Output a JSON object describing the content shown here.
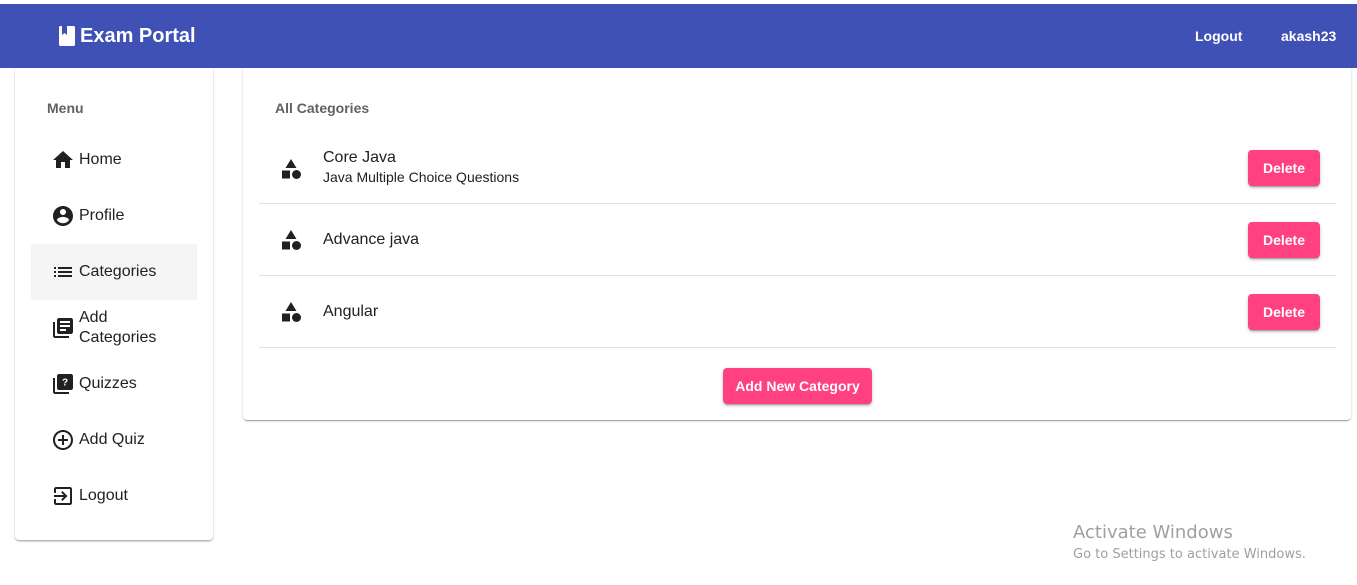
{
  "header": {
    "title": "Exam Portal",
    "logout_label": "Logout",
    "username": "akash23",
    "bg_color": "#3f51b5"
  },
  "sidebar": {
    "heading": "Menu",
    "items": [
      {
        "label": "Home",
        "icon": "home-icon"
      },
      {
        "label": "Profile",
        "icon": "account-circle-icon"
      },
      {
        "label": "Categories",
        "icon": "list-icon",
        "active": true
      },
      {
        "label": "Add\nCategories",
        "label_line1": "Add",
        "label_line2": "Categories",
        "icon": "library-books-icon"
      },
      {
        "label": "Quizzes",
        "icon": "quiz-icon"
      },
      {
        "label": "Add Quiz",
        "icon": "add-circle-icon"
      },
      {
        "label": "Logout",
        "icon": "logout-icon"
      }
    ]
  },
  "main": {
    "subtitle": "All Categories",
    "categories": [
      {
        "title": "Core Java",
        "description": "Java Multiple Choice Questions",
        "icon": "category-icon"
      },
      {
        "title": "Advance java",
        "description": "",
        "icon": "category-icon"
      },
      {
        "title": "Angular",
        "description": "",
        "icon": "category-icon"
      }
    ],
    "delete_label": "Delete",
    "add_button_label": "Add New Category",
    "accent_color": "#ff4081"
  },
  "watermark": {
    "title": "Activate Windows",
    "subtitle": "Go to Settings to activate Windows."
  }
}
